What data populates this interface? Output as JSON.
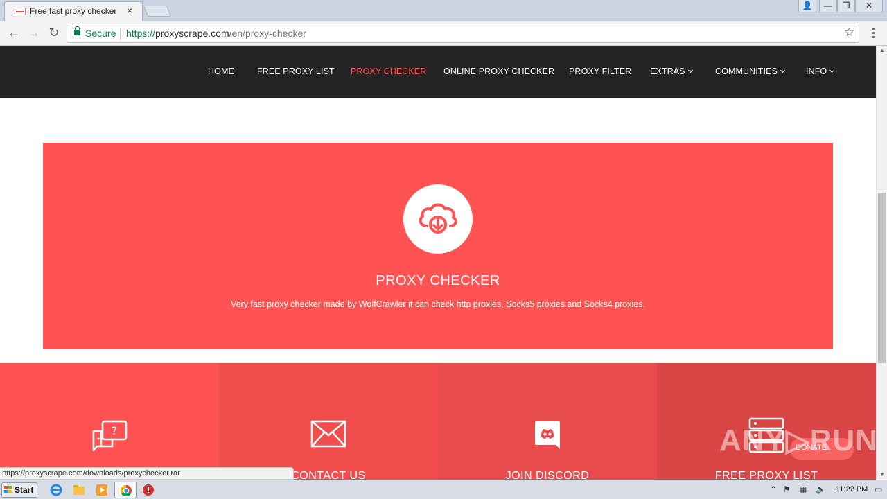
{
  "browser": {
    "tab_title": "Free fast proxy checker",
    "tab_close": "×",
    "secure_label": "Secure",
    "url_scheme": "https://",
    "url_host": "proxyscrape.com",
    "url_path": "/en/proxy-checker",
    "status_url": "https://proxyscrape.com/downloads/proxychecker.rar",
    "window_controls": [
      "👤",
      "—",
      "❐",
      "✕"
    ]
  },
  "nav": {
    "items": [
      {
        "label": "HOME",
        "active": false,
        "dropdown": false
      },
      {
        "label": "FREE PROXY LIST",
        "active": false,
        "dropdown": false
      },
      {
        "label": "PROXY CHECKER",
        "active": true,
        "dropdown": false
      },
      {
        "label": "ONLINE PROXY CHECKER",
        "active": false,
        "dropdown": false
      },
      {
        "label": "PROXY FILTER",
        "active": false,
        "dropdown": false
      },
      {
        "label": "EXTRAS",
        "active": false,
        "dropdown": true
      },
      {
        "label": "COMMUNITIES",
        "active": false,
        "dropdown": true
      },
      {
        "label": "INFO",
        "active": false,
        "dropdown": true
      }
    ]
  },
  "hero": {
    "title": "PROXY CHECKER",
    "description": "Very fast proxy checker made by WolfCrawler it can check http proxies, Socks5 proxies and Socks4 proxies."
  },
  "tiles": [
    {
      "label": "",
      "icon": "chat-question-icon",
      "color": "#ff5252"
    },
    {
      "label": "CONTACT US",
      "icon": "envelope-icon",
      "color": "#f24d4d"
    },
    {
      "label": "JOIN DISCORD",
      "icon": "discord-icon",
      "color": "#e84c4c"
    },
    {
      "label": "FREE PROXY LIST",
      "icon": "server-icon",
      "color": "#d94545"
    }
  ],
  "watermark": {
    "text": "ANY▷RUN",
    "donate": "DONATE"
  },
  "taskbar": {
    "start_label": "Start",
    "clock": "11:22 PM"
  },
  "colors": {
    "accent": "#ff5252",
    "nav_bg": "#232323",
    "secure_green": "#0b8043"
  }
}
